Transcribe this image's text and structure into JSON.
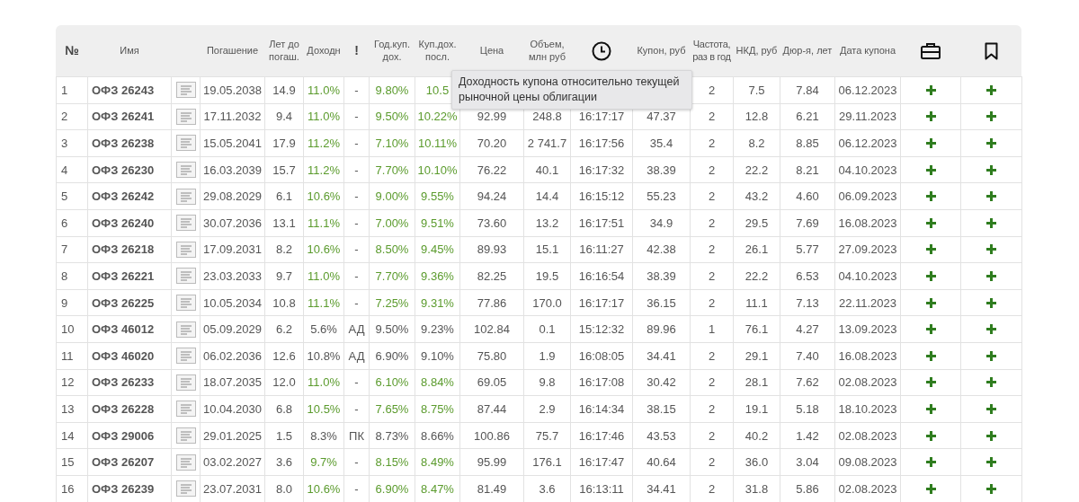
{
  "columns": [
    {
      "kind": "text",
      "label": "№",
      "bold": true
    },
    {
      "kind": "text",
      "label": "Имя",
      "bold": false
    },
    {
      "kind": "blank"
    },
    {
      "kind": "text",
      "label": "Погашение",
      "bold": false
    },
    {
      "kind": "text",
      "label": "Лет до погаш.",
      "bold": false
    },
    {
      "kind": "text",
      "label": "Доходн",
      "bold": false
    },
    {
      "kind": "text",
      "label": "!",
      "bold": true
    },
    {
      "kind": "text",
      "label": "Год.куп. дох.",
      "bold": false
    },
    {
      "kind": "text",
      "label": "Куп.дох. посл.",
      "bold": false
    },
    {
      "kind": "text",
      "label": "Цена",
      "bold": false
    },
    {
      "kind": "text",
      "label": "Объем, млн руб",
      "bold": false
    },
    {
      "kind": "time"
    },
    {
      "kind": "text",
      "label": "Купон, руб",
      "bold": false
    },
    {
      "kind": "text",
      "label": "Частота, раз в год",
      "bold": false
    },
    {
      "kind": "text",
      "label": "НКД, руб",
      "bold": false
    },
    {
      "kind": "text",
      "label": "Дюр-я, лет",
      "bold": false
    },
    {
      "kind": "text",
      "label": "Дата купона",
      "bold": false
    },
    {
      "kind": "portfolio"
    },
    {
      "kind": "favorites"
    }
  ],
  "tooltip": "Доходность купона относительно текущей рыночной цены облигации",
  "rows": [
    {
      "num": "1",
      "name": "ОФЗ 26243",
      "maturity": "19.05.2038",
      "years": "14.9",
      "yield": "11.0%",
      "flag": "-",
      "coupon_yield": "9.80%",
      "current_yield": "10.5",
      "frequency": "2",
      "accrued": "7.5",
      "duration": "7.84",
      "coupon_date": "06.12.2023",
      "accent": true
    },
    {
      "num": "2",
      "name": "ОФЗ 26241",
      "maturity": "17.11.2032",
      "years": "9.4",
      "yield": "11.0%",
      "flag": "-",
      "coupon_yield": "9.50%",
      "current_yield": "10.22%",
      "price": "92.99",
      "volume": "248.8",
      "time": "16:17:17",
      "coupon": "47.37",
      "frequency": "2",
      "accrued": "12.8",
      "duration": "6.21",
      "coupon_date": "29.11.2023",
      "accent": true
    },
    {
      "num": "3",
      "name": "ОФЗ 26238",
      "maturity": "15.05.2041",
      "years": "17.9",
      "yield": "11.2%",
      "flag": "-",
      "coupon_yield": "7.10%",
      "current_yield": "10.11%",
      "price": "70.20",
      "volume": "2 741.7",
      "time": "16:17:56",
      "coupon": "35.4",
      "frequency": "2",
      "accrued": "8.2",
      "duration": "8.85",
      "coupon_date": "06.12.2023",
      "accent": true
    },
    {
      "num": "4",
      "name": "ОФЗ 26230",
      "maturity": "16.03.2039",
      "years": "15.7",
      "yield": "11.2%",
      "flag": "-",
      "coupon_yield": "7.70%",
      "current_yield": "10.10%",
      "price": "76.22",
      "volume": "40.1",
      "time": "16:17:32",
      "coupon": "38.39",
      "frequency": "2",
      "accrued": "22.2",
      "duration": "8.21",
      "coupon_date": "04.10.2023",
      "accent": true
    },
    {
      "num": "5",
      "name": "ОФЗ 26242",
      "maturity": "29.08.2029",
      "years": "6.1",
      "yield": "10.6%",
      "flag": "-",
      "coupon_yield": "9.00%",
      "current_yield": "9.55%",
      "price": "94.24",
      "volume": "14.4",
      "time": "16:15:12",
      "coupon": "55.23",
      "frequency": "2",
      "accrued": "43.2",
      "duration": "4.60",
      "coupon_date": "06.09.2023",
      "accent": true
    },
    {
      "num": "6",
      "name": "ОФЗ 26240",
      "maturity": "30.07.2036",
      "years": "13.1",
      "yield": "11.1%",
      "flag": "-",
      "coupon_yield": "7.00%",
      "current_yield": "9.51%",
      "price": "73.60",
      "volume": "13.2",
      "time": "16:17:51",
      "coupon": "34.9",
      "frequency": "2",
      "accrued": "29.5",
      "duration": "7.69",
      "coupon_date": "16.08.2023",
      "accent": true
    },
    {
      "num": "7",
      "name": "ОФЗ 26218",
      "maturity": "17.09.2031",
      "years": "8.2",
      "yield": "10.6%",
      "flag": "-",
      "coupon_yield": "8.50%",
      "current_yield": "9.45%",
      "price": "89.93",
      "volume": "15.1",
      "time": "16:11:27",
      "coupon": "42.38",
      "frequency": "2",
      "accrued": "26.1",
      "duration": "5.77",
      "coupon_date": "27.09.2023",
      "accent": true
    },
    {
      "num": "8",
      "name": "ОФЗ 26221",
      "maturity": "23.03.2033",
      "years": "9.7",
      "yield": "11.0%",
      "flag": "-",
      "coupon_yield": "7.70%",
      "current_yield": "9.36%",
      "price": "82.25",
      "volume": "19.5",
      "time": "16:16:54",
      "coupon": "38.39",
      "frequency": "2",
      "accrued": "22.2",
      "duration": "6.53",
      "coupon_date": "04.10.2023",
      "accent": true
    },
    {
      "num": "9",
      "name": "ОФЗ 26225",
      "maturity": "10.05.2034",
      "years": "10.8",
      "yield": "11.1%",
      "flag": "-",
      "coupon_yield": "7.25%",
      "current_yield": "9.31%",
      "price": "77.86",
      "volume": "170.0",
      "time": "16:17:17",
      "coupon": "36.15",
      "frequency": "2",
      "accrued": "11.1",
      "duration": "7.13",
      "coupon_date": "22.11.2023",
      "accent": true
    },
    {
      "num": "10",
      "name": "ОФЗ 46012",
      "maturity": "05.09.2029",
      "years": "6.2",
      "yield": "5.6%",
      "flag": "АД",
      "coupon_yield": "9.50%",
      "current_yield": "9.23%",
      "price": "102.84",
      "volume": "0.1",
      "time": "15:12:32",
      "coupon": "89.96",
      "frequency": "1",
      "accrued": "76.1",
      "duration": "4.27",
      "coupon_date": "13.09.2023",
      "accent": false
    },
    {
      "num": "11",
      "name": "ОФЗ 46020",
      "maturity": "06.02.2036",
      "years": "12.6",
      "yield": "10.8%",
      "flag": "АД",
      "coupon_yield": "6.90%",
      "current_yield": "9.10%",
      "price": "75.80",
      "volume": "1.9",
      "time": "16:08:05",
      "coupon": "34.41",
      "frequency": "2",
      "accrued": "29.1",
      "duration": "7.40",
      "coupon_date": "16.08.2023",
      "accent": false
    },
    {
      "num": "12",
      "name": "ОФЗ 26233",
      "maturity": "18.07.2035",
      "years": "12.0",
      "yield": "11.0%",
      "flag": "-",
      "coupon_yield": "6.10%",
      "current_yield": "8.84%",
      "price": "69.05",
      "volume": "9.8",
      "time": "16:17:08",
      "coupon": "30.42",
      "frequency": "2",
      "accrued": "28.1",
      "duration": "7.62",
      "coupon_date": "02.08.2023",
      "accent": true
    },
    {
      "num": "13",
      "name": "ОФЗ 26228",
      "maturity": "10.04.2030",
      "years": "6.8",
      "yield": "10.5%",
      "flag": "-",
      "coupon_yield": "7.65%",
      "current_yield": "8.75%",
      "price": "87.44",
      "volume": "2.9",
      "time": "16:14:34",
      "coupon": "38.15",
      "frequency": "2",
      "accrued": "19.1",
      "duration": "5.18",
      "coupon_date": "18.10.2023",
      "accent": true
    },
    {
      "num": "14",
      "name": "ОФЗ 29006",
      "maturity": "29.01.2025",
      "years": "1.5",
      "yield": "8.3%",
      "flag": "ПК",
      "coupon_yield": "8.73%",
      "current_yield": "8.66%",
      "price": "100.86",
      "volume": "75.7",
      "time": "16:17:46",
      "coupon": "43.53",
      "frequency": "2",
      "accrued": "40.2",
      "duration": "1.42",
      "coupon_date": "02.08.2023",
      "accent": false
    },
    {
      "num": "15",
      "name": "ОФЗ 26207",
      "maturity": "03.02.2027",
      "years": "3.6",
      "yield": "9.7%",
      "flag": "-",
      "coupon_yield": "8.15%",
      "current_yield": "8.49%",
      "price": "95.99",
      "volume": "176.1",
      "time": "16:17:47",
      "coupon": "40.64",
      "frequency": "2",
      "accrued": "36.0",
      "duration": "3.04",
      "coupon_date": "09.08.2023",
      "accent": true
    },
    {
      "num": "16",
      "name": "ОФЗ 26239",
      "maturity": "23.07.2031",
      "years": "8.0",
      "yield": "10.6%",
      "flag": "-",
      "coupon_yield": "6.90%",
      "current_yield": "8.47%",
      "price": "81.49",
      "volume": "3.6",
      "time": "16:13:11",
      "coupon": "34.41",
      "frequency": "2",
      "accrued": "31.8",
      "duration": "5.86",
      "coupon_date": "02.08.2023",
      "accent": true
    }
  ]
}
